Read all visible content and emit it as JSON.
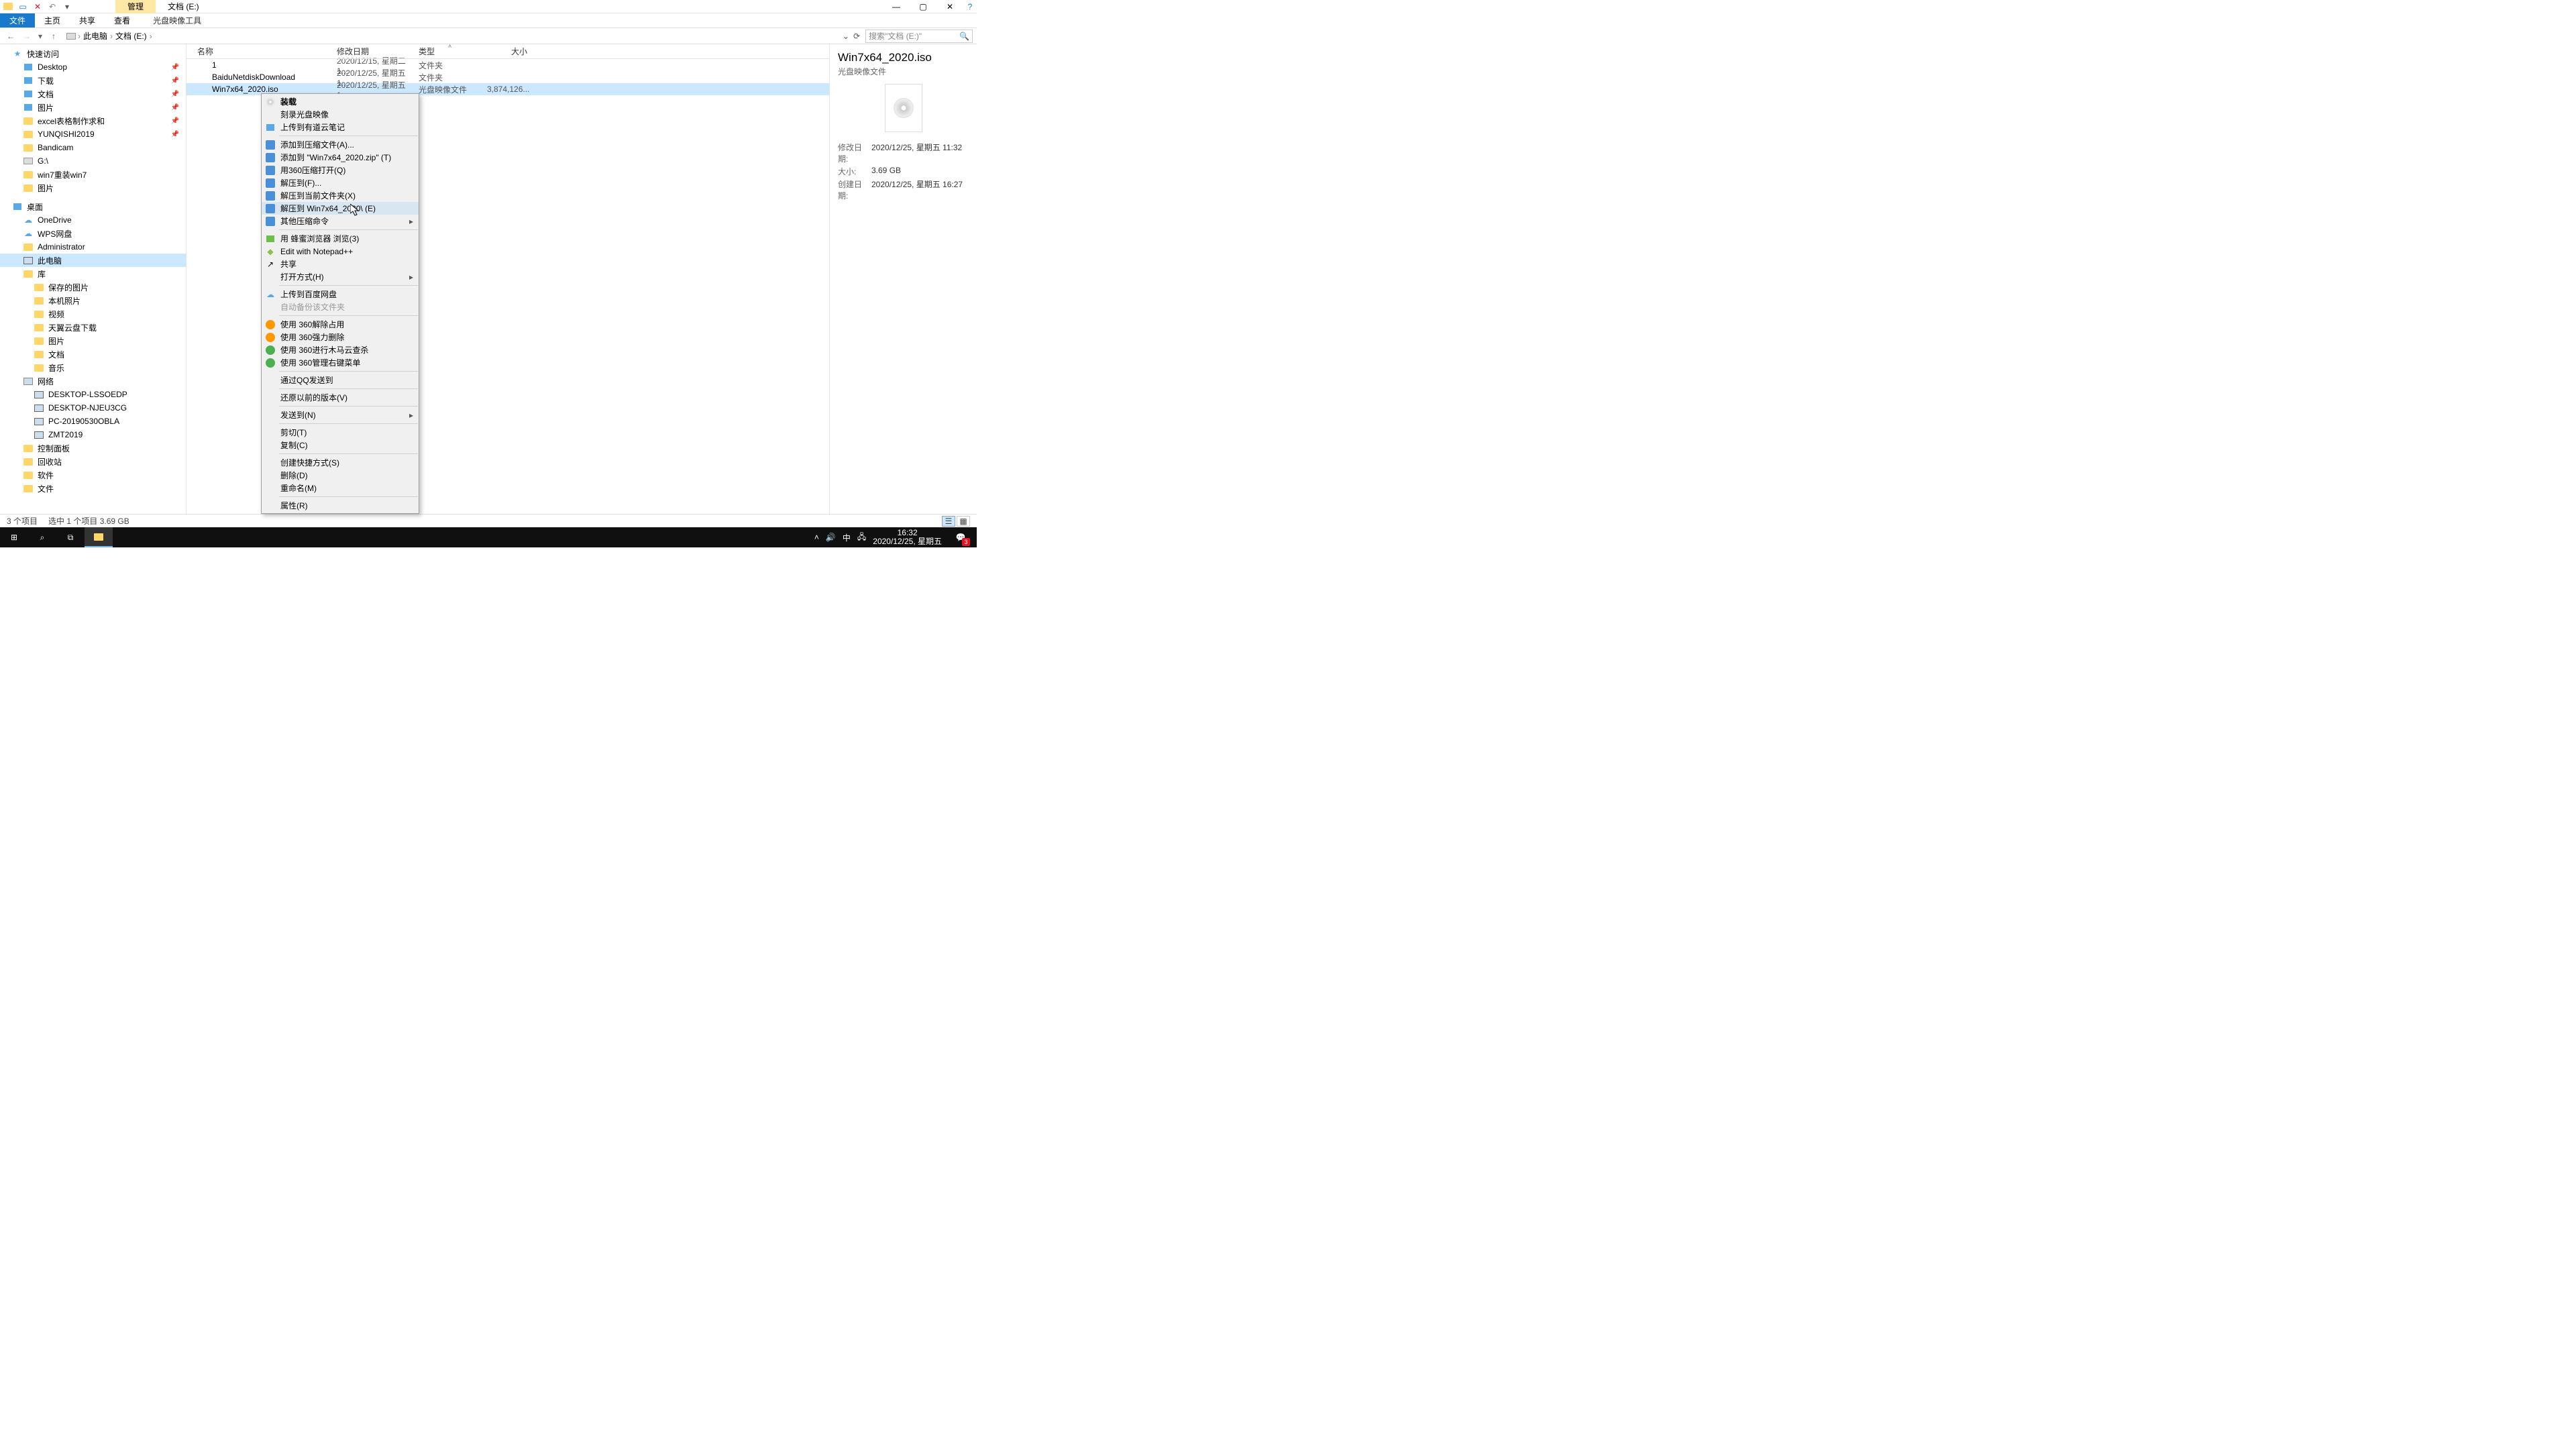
{
  "window": {
    "activeTab": "管理",
    "title": "文档 (E:)"
  },
  "ribbon": {
    "file": "文件",
    "tabs": [
      "主页",
      "共享",
      "查看"
    ],
    "tool": "光盘映像工具"
  },
  "address": {
    "root": "此电脑",
    "path": "文档 (E:)",
    "searchPlaceholder": "搜索\"文档 (E:)\""
  },
  "tree": {
    "quick": "快速访问",
    "quickItems": [
      {
        "label": "Desktop",
        "pin": true,
        "ic": "blue"
      },
      {
        "label": "下载",
        "pin": true,
        "ic": "blue"
      },
      {
        "label": "文档",
        "pin": true,
        "ic": "blue"
      },
      {
        "label": "图片",
        "pin": true,
        "ic": "blue"
      },
      {
        "label": "excel表格制作求和",
        "pin": true,
        "ic": "folder"
      },
      {
        "label": "YUNQISHI2019",
        "pin": true,
        "ic": "folder"
      },
      {
        "label": "Bandicam",
        "pin": false,
        "ic": "folder"
      },
      {
        "label": "G:\\",
        "pin": false,
        "ic": "drive"
      },
      {
        "label": "win7重装win7",
        "pin": false,
        "ic": "folder"
      },
      {
        "label": "图片",
        "pin": false,
        "ic": "folder"
      }
    ],
    "desktop": "桌面",
    "desktopItems": [
      {
        "label": "OneDrive",
        "ic": "cloud"
      },
      {
        "label": "WPS网盘",
        "ic": "cloud"
      },
      {
        "label": "Administrator",
        "ic": "folder"
      },
      {
        "label": "此电脑",
        "ic": "monitor",
        "sel": true
      },
      {
        "label": "库",
        "ic": "folder"
      }
    ],
    "libItems": [
      {
        "label": "保存的图片"
      },
      {
        "label": "本机照片"
      },
      {
        "label": "视频"
      },
      {
        "label": "天翼云盘下载"
      },
      {
        "label": "图片"
      },
      {
        "label": "文档"
      },
      {
        "label": "音乐"
      }
    ],
    "network": "网络",
    "netItems": [
      "DESKTOP-LSSOEDP",
      "DESKTOP-NJEU3CG",
      "PC-20190530OBLA",
      "ZMT2019"
    ],
    "extra": [
      "控制面板",
      "回收站",
      "软件",
      "文件"
    ]
  },
  "columns": {
    "name": "名称",
    "date": "修改日期",
    "type": "类型",
    "size": "大小"
  },
  "files": [
    {
      "name": "1",
      "date": "2020/12/15, 星期二 1...",
      "type": "文件夹",
      "size": "",
      "ic": "folder"
    },
    {
      "name": "BaiduNetdiskDownload",
      "date": "2020/12/25, 星期五 1...",
      "type": "文件夹",
      "size": "",
      "ic": "folder"
    },
    {
      "name": "Win7x64_2020.iso",
      "date": "2020/12/25, 星期五 1...",
      "type": "光盘映像文件",
      "size": "3,874,126...",
      "ic": "disc",
      "sel": true
    }
  ],
  "contextMenu": [
    {
      "label": "装载",
      "bold": true,
      "ic": "disc"
    },
    {
      "label": "刻录光盘映像"
    },
    {
      "label": "上传到有道云笔记",
      "ic": "blue"
    },
    {
      "sep": true
    },
    {
      "label": "添加到压缩文件(A)...",
      "ic": "zip"
    },
    {
      "label": "添加到 \"Win7x64_2020.zip\" (T)",
      "ic": "zip"
    },
    {
      "label": "用360压缩打开(Q)",
      "ic": "zip"
    },
    {
      "label": "解压到(F)...",
      "ic": "zip"
    },
    {
      "label": "解压到当前文件夹(X)",
      "ic": "zip"
    },
    {
      "label": "解压到 Win7x64_2020\\ (E)",
      "ic": "zip",
      "hover": true
    },
    {
      "label": "其他压缩命令",
      "ic": "zip",
      "arrow": true
    },
    {
      "sep": true
    },
    {
      "label": "用 蜂蜜浏览器 浏览(3)",
      "ic": "green"
    },
    {
      "label": "Edit with Notepad++",
      "ic": "npp"
    },
    {
      "label": "共享",
      "ic": "share"
    },
    {
      "label": "打开方式(H)",
      "arrow": true
    },
    {
      "sep": true
    },
    {
      "label": "上传到百度网盘",
      "ic": "cloud"
    },
    {
      "label": "自动备份该文件夹",
      "disabled": true
    },
    {
      "sep": true
    },
    {
      "label": "使用 360解除占用",
      "ic": "360"
    },
    {
      "label": "使用 360强力删除",
      "ic": "360"
    },
    {
      "label": "使用 360进行木马云查杀",
      "ic": "360g"
    },
    {
      "label": "使用 360管理右键菜单",
      "ic": "360g"
    },
    {
      "sep": true
    },
    {
      "label": "通过QQ发送到"
    },
    {
      "sep": true
    },
    {
      "label": "还原以前的版本(V)"
    },
    {
      "sep": true
    },
    {
      "label": "发送到(N)",
      "arrow": true
    },
    {
      "sep": true
    },
    {
      "label": "剪切(T)"
    },
    {
      "label": "复制(C)"
    },
    {
      "sep": true
    },
    {
      "label": "创建快捷方式(S)"
    },
    {
      "label": "删除(D)"
    },
    {
      "label": "重命名(M)"
    },
    {
      "sep": true
    },
    {
      "label": "属性(R)"
    }
  ],
  "preview": {
    "name": "Win7x64_2020.iso",
    "type": "光盘映像文件",
    "rows": [
      {
        "k": "修改日期:",
        "v": "2020/12/25, 星期五 11:32"
      },
      {
        "k": "大小:",
        "v": "3.69 GB"
      },
      {
        "k": "创建日期:",
        "v": "2020/12/25, 星期五 16:27"
      }
    ]
  },
  "status": {
    "count": "3 个项目",
    "sel": "选中 1 个项目  3.69 GB"
  },
  "taskbar": {
    "time": "16:32",
    "date": "2020/12/25, 星期五",
    "ime": "中",
    "badge": "3"
  }
}
